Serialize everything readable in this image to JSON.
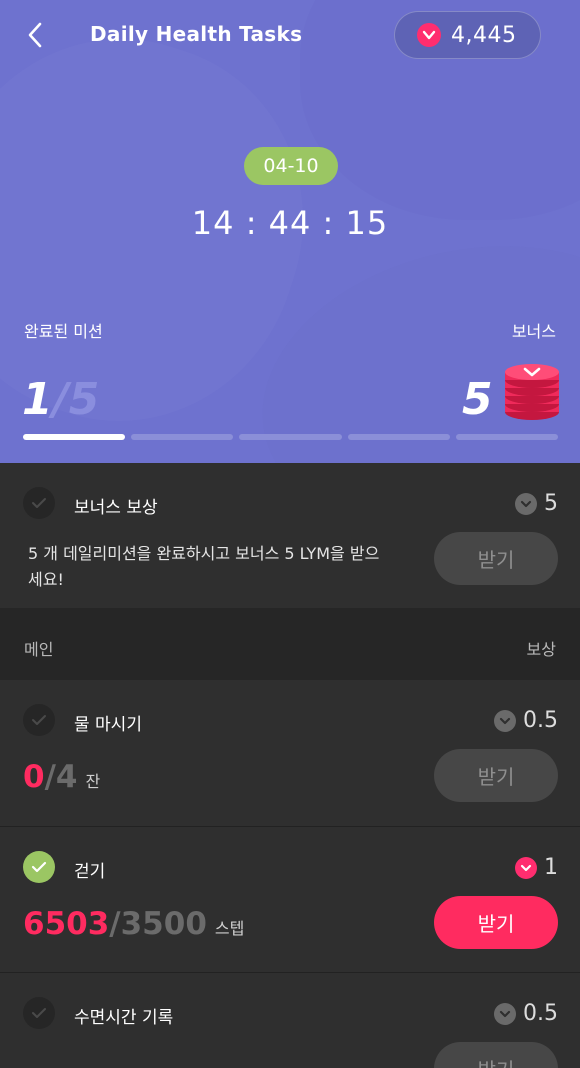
{
  "header": {
    "title": "Daily Health Tasks",
    "balance": "4,445",
    "date": "04-10",
    "timer": "14 : 44 : 15",
    "completed_label": "완료된 미션",
    "bonus_label": "보너스",
    "completed_count": "1",
    "total_count": "/5",
    "bonus_value": "5",
    "progress": {
      "completed": 1,
      "total": 5
    }
  },
  "bonus_task": {
    "name": "보너스 보상",
    "reward": "5",
    "description": "5 개 데일리미션을 완료하시고 보너스 5 LYM을 받으세요!",
    "button": "받기"
  },
  "section": {
    "left": "메인",
    "right": "보상"
  },
  "tasks": [
    {
      "name": "물 마시기",
      "reward": "0.5",
      "current": "0",
      "target": "/4",
      "unit": "잔",
      "button": "받기",
      "done": false
    },
    {
      "name": "걷기",
      "reward": "1",
      "current": "6503",
      "target": "/3500",
      "unit": "스텝",
      "button": "받기",
      "done": true
    },
    {
      "name": "수면시간 기록",
      "reward": "0.5",
      "button": "받기",
      "done": false
    }
  ],
  "colors": {
    "accent_pink": "#ff2b60",
    "header_bg": "#6e72cf",
    "done_green": "#9bc663"
  },
  "icons": {
    "back": "chevron-left-icon",
    "coin": "heart-coin-icon",
    "check": "check-icon",
    "bonus": "coin-stack-icon"
  }
}
